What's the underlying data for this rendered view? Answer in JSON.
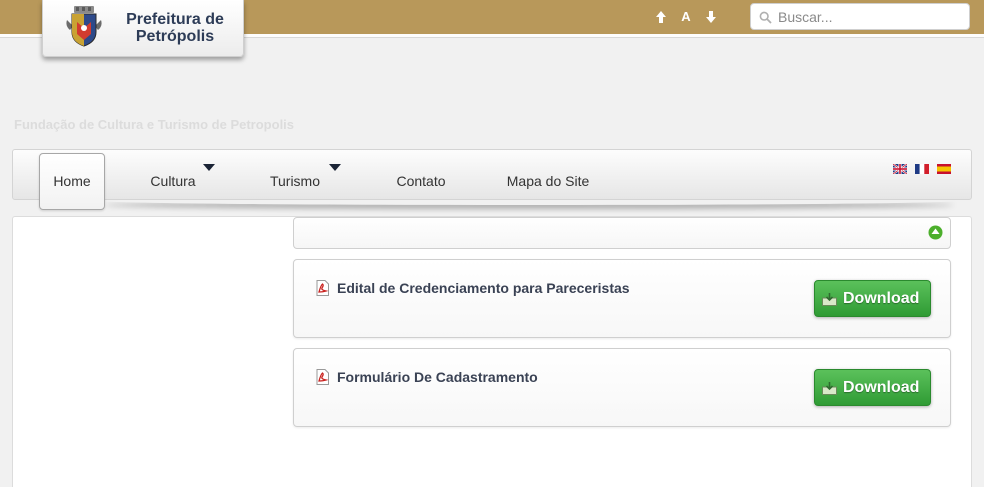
{
  "header": {
    "logo_line1": "Prefeitura de",
    "logo_line2": "Petrópolis",
    "font_size_label": "A",
    "search": {
      "placeholder": "Buscar..."
    }
  },
  "subtitle": "Fundação de Cultura e Turismo de Petropolis",
  "nav": {
    "items": [
      {
        "label": "Home"
      },
      {
        "label": "Cultura"
      },
      {
        "label": "Turismo"
      },
      {
        "label": "Contato"
      },
      {
        "label": "Mapa do Site"
      }
    ],
    "languages": [
      "english-flag-icon",
      "french-flag-icon",
      "spanish-flag-icon"
    ]
  },
  "documents": [
    {
      "title": "Edital de Credenciamento para Pareceristas",
      "button_label": "Download"
    },
    {
      "title": "Formulário De Cadastramento",
      "button_label": "Download"
    }
  ],
  "colors": {
    "topbar": "#b8985a",
    "logo_text": "#2d3c57",
    "download_button": "#3aa83d",
    "back_to_top": "#4caf2c"
  },
  "icons": {
    "increase_font": "arrow-up-icon",
    "decrease_font": "arrow-down-icon",
    "search": "search-icon",
    "document": "pdf-icon",
    "download": "download-icon",
    "back_to_top": "back-to-top-icon"
  }
}
